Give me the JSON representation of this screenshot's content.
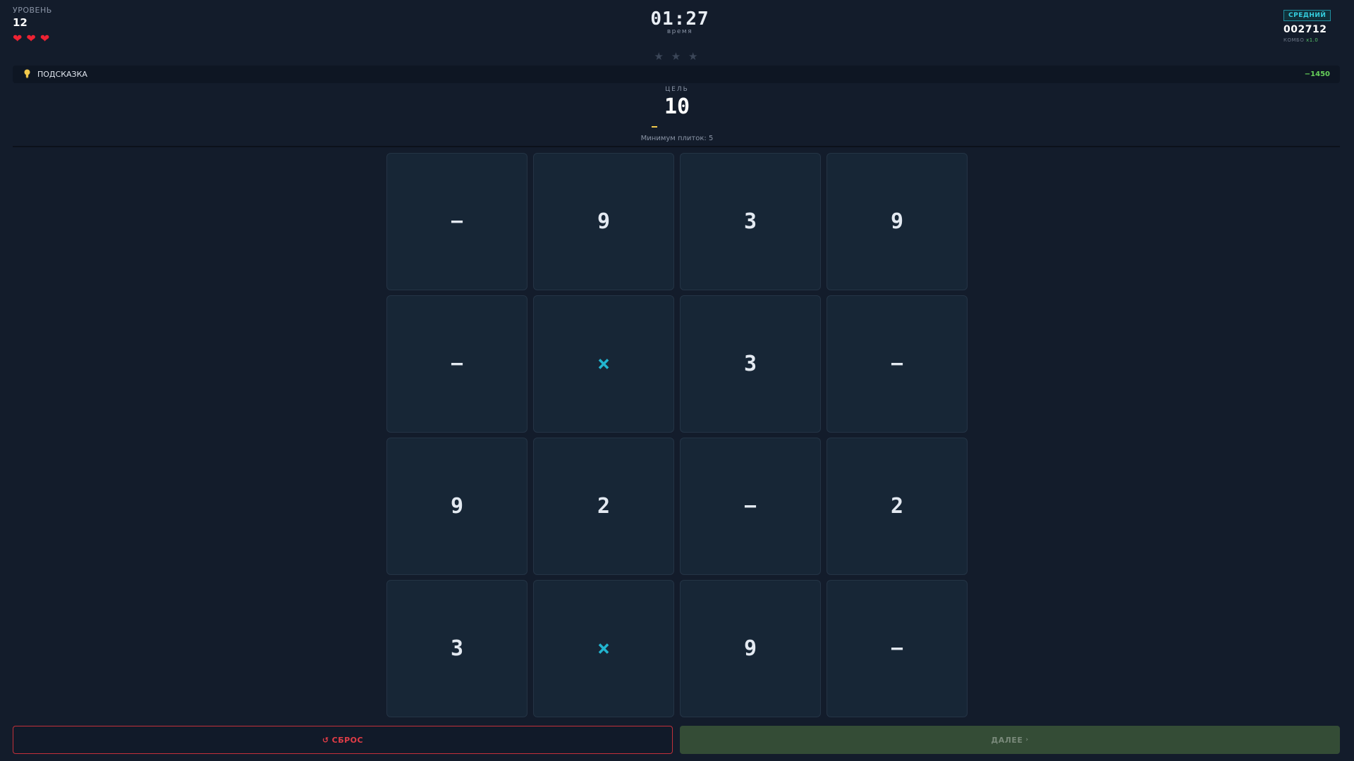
{
  "header": {
    "level_label": "УРОВЕНЬ",
    "level_value": "12",
    "hearts_count": 3,
    "heart_icon": "heart-icon",
    "timer": "01:27",
    "timer_label": "время",
    "stars": "★ ★ ★",
    "stars_earned": 0,
    "difficulty": "СРЕДНИЙ",
    "score": "002712",
    "combo_label": "КОМБО",
    "combo_value": "x1.0"
  },
  "hint": {
    "icon": "lightbulb-icon",
    "label": "ПОДСКАЗКА",
    "cost": "−1450"
  },
  "goal": {
    "label": "ЦЕЛЬ",
    "value": "10",
    "min_tiles": "Минимум плиток: 5"
  },
  "grid": {
    "tiles": [
      "−",
      "9",
      "3",
      "9",
      "−",
      "×",
      "3",
      "−",
      "9",
      "2",
      "−",
      "2",
      "3",
      "×",
      "9",
      "−"
    ]
  },
  "buttons": {
    "reset_icon": "↺",
    "reset_label": "СБРОС",
    "next_label": "ДАЛЕЕ",
    "next_chevron": "›"
  },
  "colors": {
    "background": "#131c2b",
    "tile": "#172636",
    "accent_multiply": "#22b5d0",
    "heart": "#ee2233",
    "reset": "#e33d47",
    "next": "#344c36",
    "hint_cost": "#67d05a"
  }
}
